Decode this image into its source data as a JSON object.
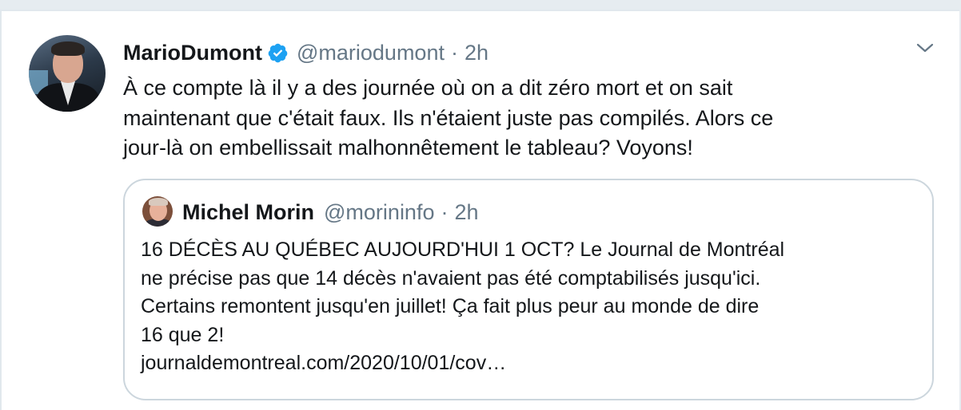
{
  "tweet": {
    "author_name": "MarioDumont",
    "verified": true,
    "handle": "@mariodumont",
    "separator": "·",
    "time": "2h",
    "text": "À ce compte là il y a des journée où on a dit zéro mort et on sait\nmaintenant que c'était faux.  Ils n'étaient juste pas compilés.  Alors ce\njour-là on embellissait malhonnêtement le tableau? Voyons!"
  },
  "quoted": {
    "author_name": "Michel Morin",
    "handle": "@morininfo",
    "separator": "·",
    "time": "2h",
    "text": "16 DÉCÈS AU QUÉBEC AUJOURD'HUI 1 OCT? Le Journal de Montréal\nne précise pas que 14 décès n'avaient pas  été comptabilisés jusqu'ici.\nCertains remontent jusqu'en juillet! Ça fait plus peur au monde de dire\n16 que 2!\njournaldemontreal.com/2020/10/01/cov…"
  },
  "colors": {
    "text": "#14171a",
    "secondary": "#657786",
    "verified": "#1da1f2",
    "border": "#ccd6dd",
    "background": "#e6ecf0"
  },
  "icons": {
    "verified": "verified-badge-icon",
    "menu": "chevron-down-icon"
  }
}
